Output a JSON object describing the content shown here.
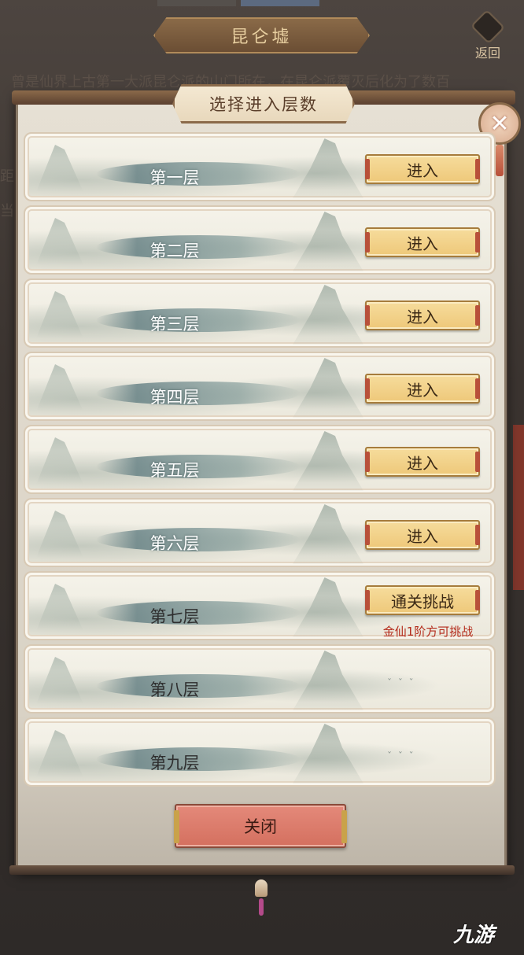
{
  "background": {
    "title": "昆仑墟",
    "back_label": "返回",
    "description": "曾是仙界上古第一大派昆仑派的山门所在，在昆仑派覆灭后化为了数百",
    "side_char_a": "距",
    "side_char_b": "当"
  },
  "modal": {
    "title": "选择进入层数",
    "close_label": "关闭",
    "layers": [
      {
        "name": "第一层",
        "action": "进入"
      },
      {
        "name": "第二层",
        "action": "进入"
      },
      {
        "name": "第三层",
        "action": "进入"
      },
      {
        "name": "第四层",
        "action": "进入"
      },
      {
        "name": "第五层",
        "action": "进入"
      },
      {
        "name": "第六层",
        "action": "进入"
      },
      {
        "name": "第七层",
        "action": "通关挑战",
        "requirement": "金仙1阶方可挑战"
      },
      {
        "name": "第八层"
      },
      {
        "name": "第九层"
      }
    ]
  },
  "watermark": "九游",
  "colors": {
    "enter_button": "#eec879",
    "close_button": "#d4705f",
    "requirement_text": "#b42a1a"
  }
}
